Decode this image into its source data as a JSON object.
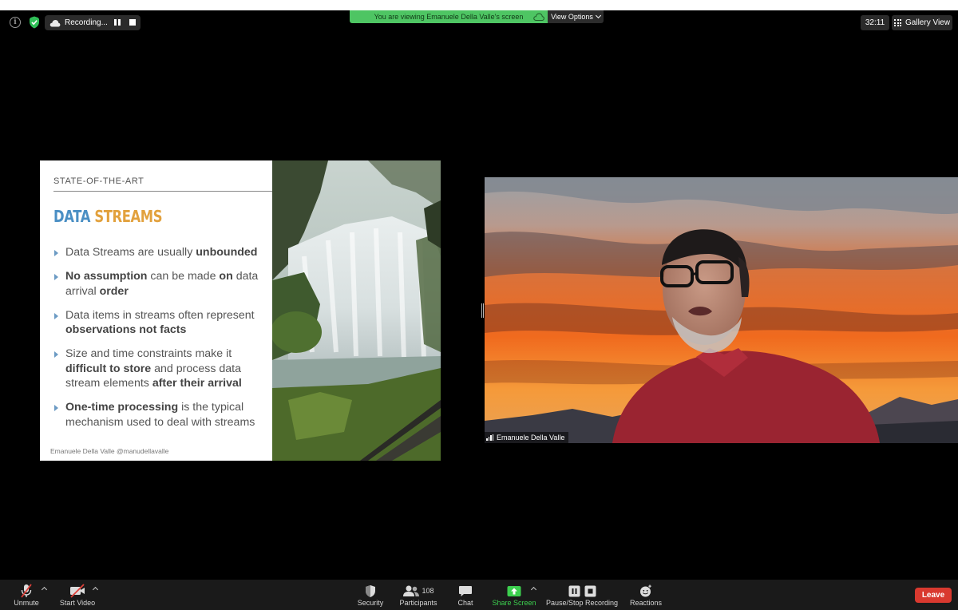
{
  "top_bar": {
    "recording_label": "Recording...",
    "viewing_banner": "You are viewing Emanuele Della Valle's screen",
    "view_options_label": "View Options",
    "timer": "32:11",
    "gallery_view_label": "Gallery View"
  },
  "slide": {
    "kicker": "STATE-OF-THE-ART",
    "title_part1": "DATA",
    "title_part2": "STREAMS",
    "bullets": [
      {
        "t1": "Data Streams are usually ",
        "b1": "unbounded",
        "t2": "",
        "b2": "",
        "t3": "",
        "b3": "",
        "t4": ""
      },
      {
        "t1": "",
        "b1": "No assumption",
        "t2": " can be made ",
        "b2": "on",
        "t3": " data arrival ",
        "b3": "order",
        "t4": ""
      },
      {
        "t1": "Data items in streams often represent ",
        "b1": "observations not facts",
        "t2": "",
        "b2": "",
        "t3": "",
        "b3": "",
        "t4": ""
      },
      {
        "t1": "Size and time constraints make it ",
        "b1": "difficult to store",
        "t2": " and process data stream elements ",
        "b2": "after their arrival",
        "t3": "",
        "b3": "",
        "t4": ""
      },
      {
        "t1": "",
        "b1": "One-time processing",
        "t2": " is the typical mechanism used to deal with streams",
        "b2": "",
        "t3": "",
        "b3": "",
        "t4": ""
      }
    ],
    "footer": "Emanuele Della Valle @manudellavalle"
  },
  "video": {
    "participant_name": "Emanuele Della Valle"
  },
  "toolbar": {
    "unmute": "Unmute",
    "start_video": "Start Video",
    "security": "Security",
    "participants": "Participants",
    "participants_count": "108",
    "chat": "Chat",
    "share_screen": "Share Screen",
    "pause_stop_recording": "Pause/Stop Recording",
    "reactions": "Reactions",
    "leave": "Leave"
  },
  "colors": {
    "banner_green": "#4ec563",
    "share_green": "#3ccf4e",
    "leave_red": "#d9392f",
    "title_blue": "#4a8fc4",
    "title_orange": "#e2a13d"
  },
  "icons": [
    "info-icon",
    "shield-check-icon",
    "cloud-icon",
    "pause-icon",
    "stop-icon",
    "grid-icon",
    "mic-muted-icon",
    "video-off-icon",
    "security-shield-icon",
    "participants-icon",
    "chat-bubble-icon",
    "share-arrow-icon",
    "reactions-smiley-icon",
    "signal-bars-icon"
  ]
}
